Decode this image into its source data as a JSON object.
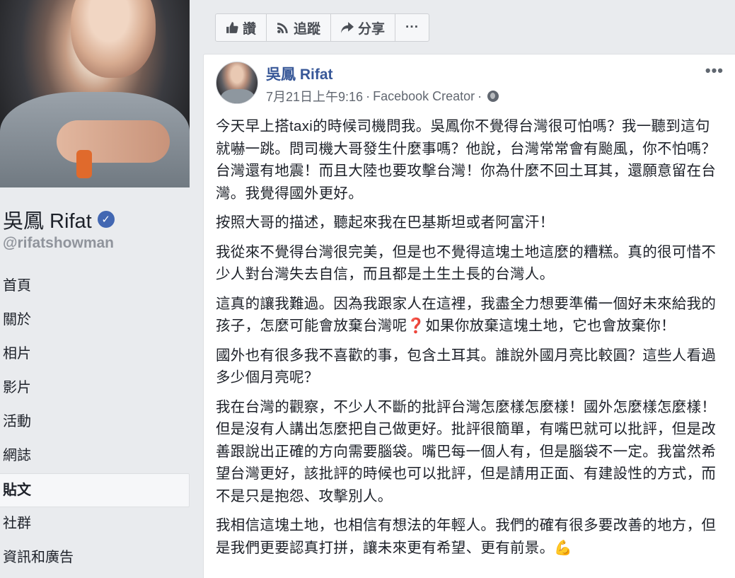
{
  "page": {
    "name": "吳鳳 Rifat",
    "handle": "@rifatshowman",
    "verified_mark": "✓"
  },
  "nav": {
    "items": [
      {
        "label": "首頁"
      },
      {
        "label": "關於"
      },
      {
        "label": "相片"
      },
      {
        "label": "影片"
      },
      {
        "label": "活動"
      },
      {
        "label": "網誌"
      },
      {
        "label": "貼文",
        "active": true
      },
      {
        "label": "社群"
      },
      {
        "label": "資訊和廣告"
      }
    ]
  },
  "actions": {
    "like_label": "讚",
    "follow_label": "追蹤",
    "share_label": "分享",
    "more_label": "···"
  },
  "post": {
    "author": "吳鳳 Rifat",
    "date": "7月21日上午9:16",
    "separator": "·",
    "source": "Facebook Creator",
    "menu": "•••",
    "paragraphs": [
      "今天早上搭taxi的時候司機問我。吳鳳你不覺得台灣很可怕嗎？我一聽到這句就嚇一跳。問司機大哥發生什麼事嗎？他說，台灣常常會有颱風，你不怕嗎？台灣還有地震！而且大陸也要攻擊台灣！你為什麼不回土耳其，還願意留在台灣。我覺得國外更好。",
      "按照大哥的描述，聽起來我在巴基斯坦或者阿富汗！",
      "我從來不覺得台灣很完美，但是也不覺得這塊土地這麼的糟糕。真的很可惜不少人對台灣失去自信，而且都是土生土長的台灣人。",
      "這真的讓我難過。因為我跟家人在這裡，我盡全力想要準備一個好未來給我的孩子，怎麼可能會放棄台灣呢❓如果你放棄這塊土地，它也會放棄你！",
      "國外也有很多我不喜歡的事，包含土耳其。誰說外國月亮比較圓？這些人看過多少個月亮呢？",
      "我在台灣的觀察，不少人不斷的批評台灣怎麼樣怎麼樣！國外怎麼樣怎麼樣！但是沒有人講出怎麼把自己做更好。批評很簡單，有嘴巴就可以批評，但是改善跟說出正確的方向需要腦袋。嘴巴每一個人有，但是腦袋不一定。我當然希望台灣更好，該批評的時候也可以批評，但是請用正面、有建設性的方式，而不是只是抱怨、攻擊別人。",
      "我相信這塊土地，也相信有想法的年輕人。我們的確有很多要改善的地方，但是我們更要認真打拼，讓未來更有希望、更有前景。💪"
    ]
  },
  "colors": {
    "link": "#385898",
    "background": "#e9ebee",
    "verified": "#4267b2"
  }
}
